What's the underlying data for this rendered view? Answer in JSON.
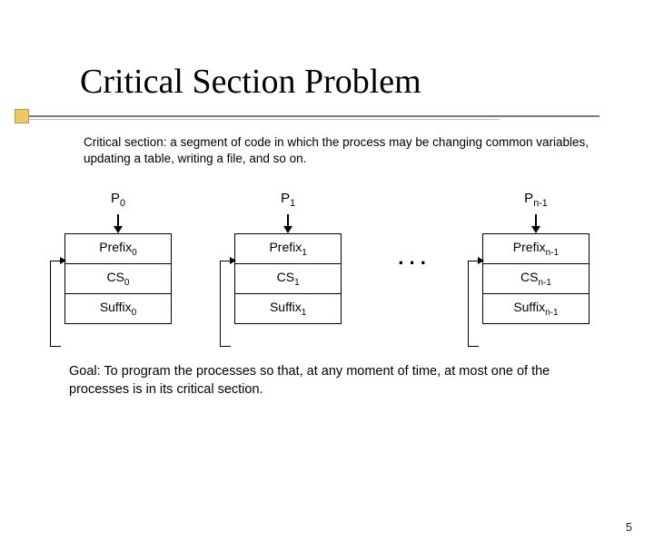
{
  "title": "Critical Section Problem",
  "intro": "Critical section: a segment of code in which the process may be changing common variables, updating a table, writing a file, and so on.",
  "processes": [
    {
      "label_base": "P",
      "label_sub": "0",
      "prefix_base": "Prefix",
      "prefix_sub": "0",
      "cs_base": "CS",
      "cs_sub": "0",
      "suffix_base": "Suffix",
      "suffix_sub": "0"
    },
    {
      "label_base": "P",
      "label_sub": "1",
      "prefix_base": "Prefix",
      "prefix_sub": "1",
      "cs_base": "CS",
      "cs_sub": "1",
      "suffix_base": "Suffix",
      "suffix_sub": "1"
    },
    {
      "label_base": "P",
      "label_sub": "n-1",
      "prefix_base": "Prefix",
      "prefix_sub": "n-1",
      "cs_base": "CS",
      "cs_sub": "n-1",
      "suffix_base": "Suffix",
      "suffix_sub": "n-1"
    }
  ],
  "ellipsis": ". . .",
  "goal": "Goal: To program the processes so that, at any moment of time, at most one of the processes is in its critical section.",
  "page_number": "5",
  "accent_color": "#efc863"
}
